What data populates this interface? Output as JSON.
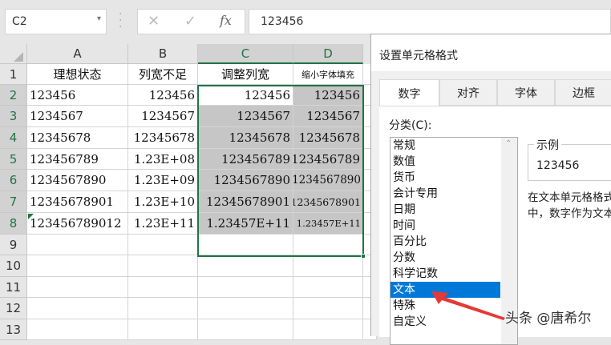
{
  "namebox": "C2",
  "formula": {
    "cancel": "✕",
    "enter": "✓",
    "fx": "fx",
    "value": "123456"
  },
  "columns": [
    "A",
    "B",
    "C",
    "D"
  ],
  "rows": [
    "1",
    "2",
    "3",
    "4",
    "5",
    "6",
    "7",
    "8",
    "9",
    "10",
    "11",
    "12",
    "13"
  ],
  "headers": [
    "理想状态",
    "列宽不足",
    "调整列宽",
    "缩小字体填充"
  ],
  "data": [
    [
      "123456",
      "123456",
      "123456",
      "123456"
    ],
    [
      "1234567",
      "1234567",
      "1234567",
      "1234567"
    ],
    [
      "12345678",
      "12345678",
      "12345678",
      "12345678"
    ],
    [
      "123456789",
      "1.23E+08",
      "123456789",
      "123456789"
    ],
    [
      "1234567890",
      "1.23E+09",
      "1234567890",
      "1234567890"
    ],
    [
      "12345678901",
      "1.23E+10",
      "12345678901",
      "12345678901"
    ],
    [
      "123456789012",
      "1.23E+11",
      "1.23457E+11",
      "1.23457E+11"
    ]
  ],
  "dialog": {
    "title": "设置单元格格式",
    "tabs": [
      "数字",
      "对齐",
      "字体",
      "边框"
    ],
    "category_label": "分类(C):",
    "categories": [
      "常规",
      "数值",
      "货币",
      "会计专用",
      "日期",
      "时间",
      "百分比",
      "分数",
      "科学记数",
      "文本",
      "特殊",
      "自定义"
    ],
    "selected_category": "文本",
    "sample_label": "示例",
    "sample_value": "123456",
    "description": "在文本单元格格式中，数字作为文本处理。单元格显示的内容与输入的内容完全一致。"
  },
  "watermark": "头条 @唐希尔",
  "colors": {
    "accent": "#217346",
    "selection": "#0078d7",
    "arrow": "#e53935"
  }
}
